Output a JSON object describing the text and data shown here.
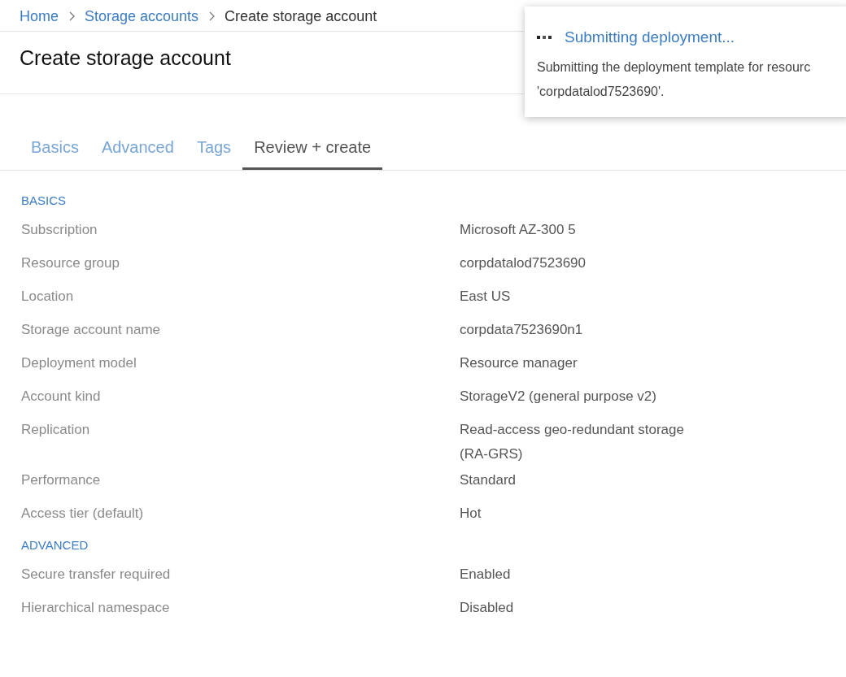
{
  "breadcrumb": [
    {
      "label": "Home",
      "link": true
    },
    {
      "label": "Storage accounts",
      "link": true
    },
    {
      "label": "Create storage account",
      "link": false
    }
  ],
  "title": "Create storage account",
  "notification": {
    "title": "Submitting deployment...",
    "message": "Submitting the deployment template for resourc",
    "message_line2": "'corpdatalod7523690'."
  },
  "tabs": [
    {
      "label": "Basics",
      "selected": false
    },
    {
      "label": "Advanced",
      "selected": false
    },
    {
      "label": "Tags",
      "selected": false
    },
    {
      "label": "Review + create",
      "selected": true
    }
  ],
  "sections": [
    {
      "heading": "BASICS",
      "rows": [
        {
          "label": "Subscription",
          "value": "Microsoft AZ-300 5"
        },
        {
          "label": "Resource group",
          "value": "corpdatalod7523690"
        },
        {
          "label": "Location",
          "value": "East US"
        },
        {
          "label": "Storage account name",
          "value": "corpdata7523690n1"
        },
        {
          "label": "Deployment model",
          "value": "Resource manager"
        },
        {
          "label": "Account kind",
          "value": "StorageV2 (general purpose v2)"
        },
        {
          "label": "Replication",
          "value": "Read-access geo-redundant storage (RA-GRS)"
        },
        {
          "label": "Performance",
          "value": "Standard"
        },
        {
          "label": "Access tier (default)",
          "value": "Hot"
        }
      ]
    },
    {
      "heading": "ADVANCED",
      "rows": [
        {
          "label": "Secure transfer required",
          "value": "Enabled"
        },
        {
          "label": "Hierarchical namespace",
          "value": "Disabled"
        }
      ]
    }
  ]
}
